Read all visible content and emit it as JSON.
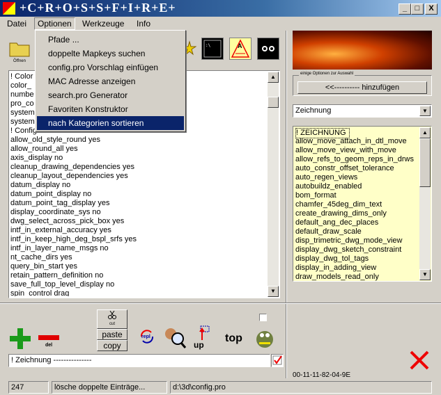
{
  "window": {
    "title": "+C+R+O+S+S+F+I+R+E+",
    "min": "_",
    "max": "□",
    "close": "X"
  },
  "menubar": {
    "items": [
      "Datei",
      "Optionen",
      "Werkzeuge",
      "Info"
    ]
  },
  "dropdown": {
    "items": [
      "Pfade ...",
      "doppelte Mapkeys suchen",
      "config.pro Vorschlag einfügen",
      "MAC Adresse anzeigen",
      "search.pro Generator",
      "Favoriten Konstruktor",
      "nach Kategorien sortieren"
    ]
  },
  "toolbar": {
    "folder_label": "Öffnen",
    "top_label": "top",
    "cut_label": "cut",
    "paste_label": "paste",
    "copy_label": "copy",
    "del_label": "del",
    "up_label": "up",
    "repl_label": "repl"
  },
  "left_list": {
    "items": [
      "! Color",
      "color_",
      "numbe",
      "pro_co",
      "system",
      "system",
      "! Configuration",
      "allow_old_style_round yes",
      "allow_round_all yes",
      "axis_display no",
      "cleanup_drawing_dependencies yes",
      "cleanup_layout_dependencies yes",
      "datum_display no",
      "datum_point_display no",
      "datum_point_tag_display yes",
      "display_coordinate_sys no",
      "dwg_select_across_pick_box yes",
      "intf_in_external_accuracy yes",
      "intf_in_keep_high_deg_bspl_srfs yes",
      "intf_in_layer_name_msgs no",
      "nt_cache_dirs yes",
      "query_bin_start yes",
      "retain_pattern_definition no",
      "save_full_top_level_display no",
      "spin_control drag"
    ]
  },
  "right_panel": {
    "group_label": "einige Optionen zur Auswahl",
    "add_button": "<<---------- hinzufügen",
    "category_select": "Zeichnung",
    "items": [
      "! ZEICHNUNG",
      "allow_move_attach_in_dtl_move",
      "allow_move_view_with_move",
      "allow_refs_to_geom_reps_in_drws",
      "auto_constr_offset_tolerance",
      "auto_regen_views",
      "autobuildz_enabled",
      "bom_format",
      "chamfer_45deg_dim_text",
      "create_drawing_dims_only",
      "default_ang_dec_places",
      "default_draw_scale",
      "disp_trimetric_dwg_mode_view",
      "display_dwg_sketch_constraint",
      "display_dwg_tol_tags",
      "display_in_adding_view",
      "draw_models_read_only"
    ],
    "mac": "00-11-11-82-04-9E"
  },
  "input": {
    "value": "! Zeichnung ---------------"
  },
  "statusbar": {
    "count": "247",
    "message": "lösche doppelte Einträge...",
    "path": "d:\\3d\\config.pro"
  },
  "colors": {
    "title_start": "#0a246a",
    "title_end": "#a6caf0",
    "selection": "#0a246a",
    "right_list_bg": "#ffffc8",
    "plus": "#1a9a1a",
    "minus": "#e00000"
  }
}
